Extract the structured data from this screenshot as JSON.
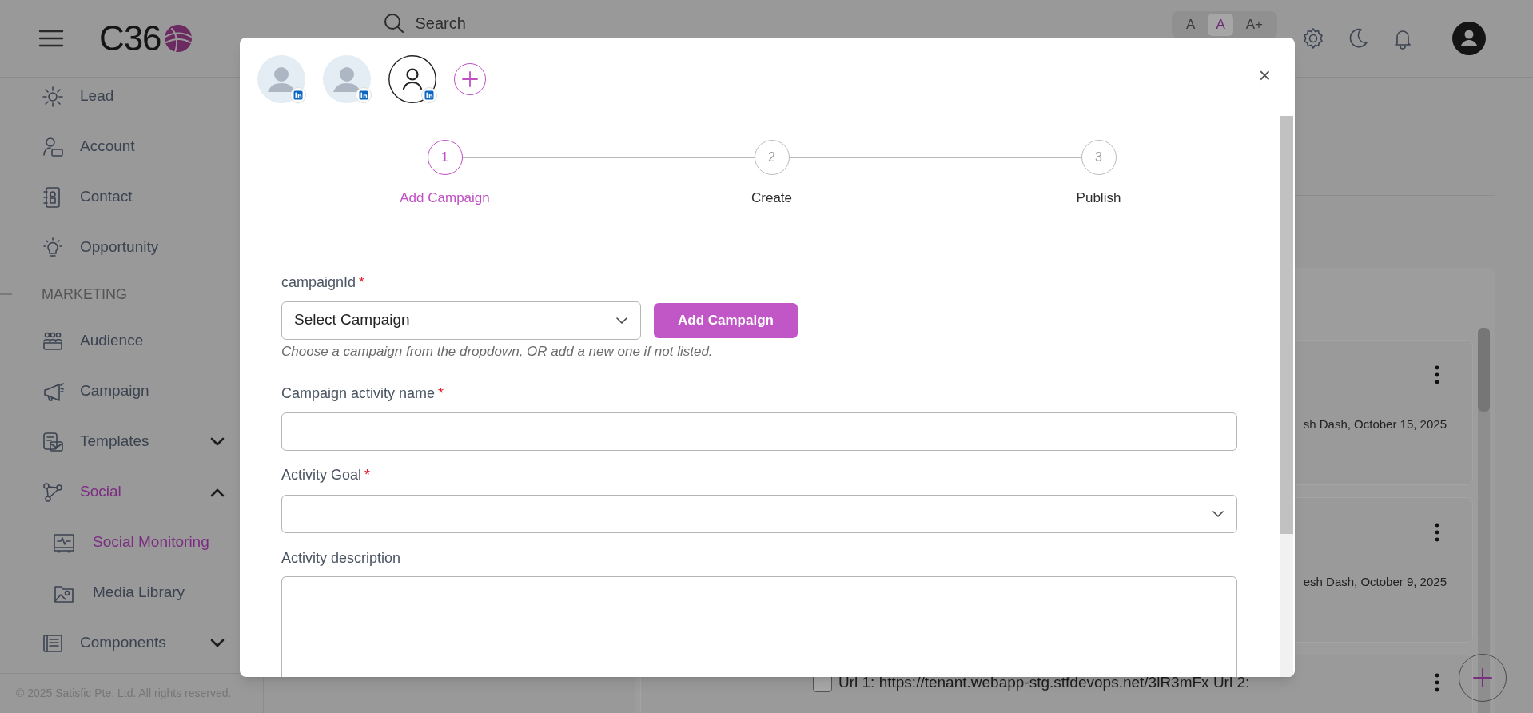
{
  "header": {
    "logo": "C36",
    "search": {
      "placeholder": "Search"
    },
    "font_sizes": [
      {
        "label": "A",
        "selected": false
      },
      {
        "label": "A",
        "selected": true
      },
      {
        "label": "A+",
        "selected": false
      }
    ]
  },
  "sidebar": {
    "items": [
      {
        "kind": "item",
        "label": "Lead",
        "selected": false
      },
      {
        "kind": "item",
        "label": "Account",
        "selected": false
      },
      {
        "kind": "item",
        "label": "Contact",
        "selected": false
      },
      {
        "kind": "item",
        "label": "Opportunity",
        "selected": false
      },
      {
        "kind": "section",
        "label": "MARKETING"
      },
      {
        "kind": "item",
        "label": "Audience",
        "selected": false
      },
      {
        "kind": "item",
        "label": "Campaign",
        "selected": false
      },
      {
        "kind": "item",
        "label": "Templates",
        "selected": false,
        "expanded": false
      },
      {
        "kind": "item",
        "label": "Social",
        "selected": true,
        "expanded": true,
        "children": [
          {
            "label": "Social Monitoring",
            "selected": true
          },
          {
            "label": "Media Library",
            "selected": false
          }
        ]
      },
      {
        "kind": "item",
        "label": "Components",
        "selected": false,
        "expanded": false
      }
    ],
    "footer": "© 2025 Satisfic Pte. Ltd. All rights reserved."
  },
  "background": {
    "cards": [
      {
        "kind": "byline",
        "text": "sh Dash, October 15, 2025"
      },
      {
        "kind": "byline",
        "text": "esh Dash, October 9, 2025"
      },
      {
        "kind": "checkbox",
        "text": "Url 1: https://tenant.webapp-stg.stfdevops.net/3lR3mFx Url 2:",
        "checked": false
      }
    ]
  },
  "modal": {
    "accounts": [
      {
        "kind": "photo",
        "selected": false
      },
      {
        "kind": "photo",
        "selected": false
      },
      {
        "kind": "outline",
        "selected": true
      }
    ],
    "close": "×",
    "steps": [
      {
        "number": "1",
        "label": "Add Campaign",
        "selected": true
      },
      {
        "number": "2",
        "label": "Create",
        "selected": false
      },
      {
        "number": "3",
        "label": "Publish",
        "selected": false
      }
    ],
    "fields": [
      {
        "kind": "select",
        "label": "campaignId",
        "marker": "*",
        "value": "Select Campaign",
        "button": "Add Campaign",
        "hint": "Choose a campaign from the dropdown, OR add a new one if not listed."
      },
      {
        "kind": "text",
        "label": "Campaign activity name",
        "marker": "*"
      },
      {
        "kind": "select",
        "label": "Activity Goal",
        "marker": "*"
      },
      {
        "kind": "textarea",
        "label": "Activity description"
      }
    ]
  }
}
